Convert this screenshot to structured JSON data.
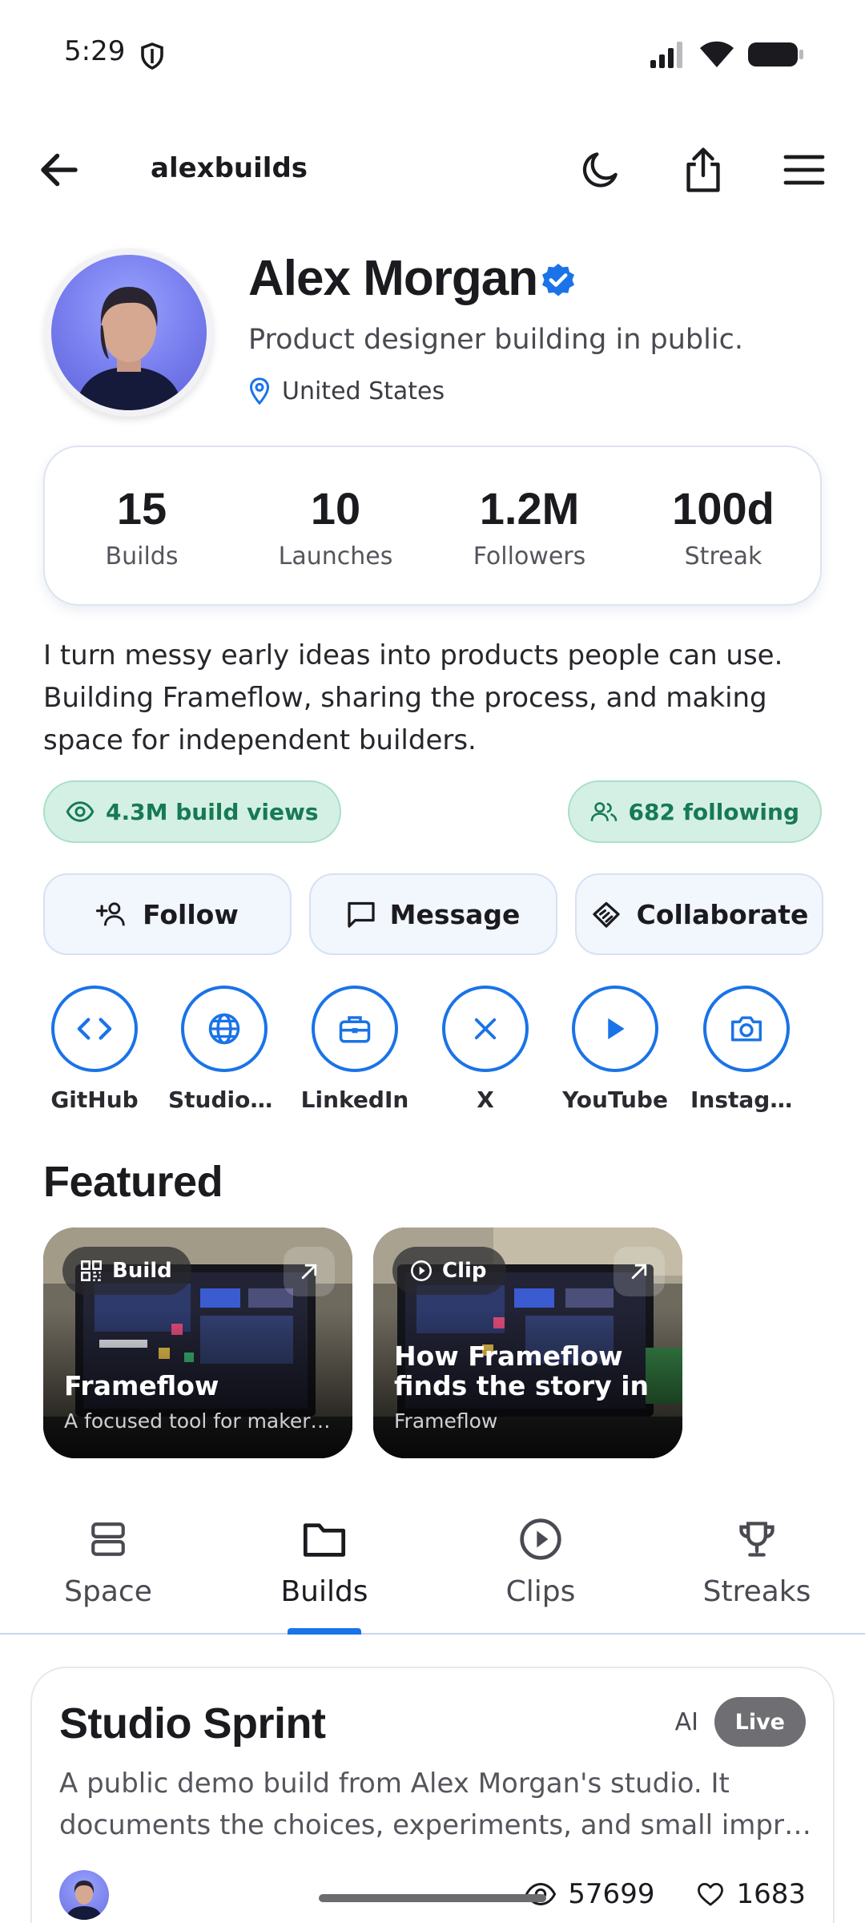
{
  "status_bar": {
    "time": "5:29"
  },
  "app_bar": {
    "handle": "alexbuilds"
  },
  "profile": {
    "name": "Alex Morgan",
    "tagline": "Product designer building in public.",
    "location": "United States"
  },
  "stats": [
    {
      "value": "15",
      "label": "Builds"
    },
    {
      "value": "10",
      "label": "Launches"
    },
    {
      "value": "1.2M",
      "label": "Followers"
    },
    {
      "value": "100d",
      "label": "Streak"
    }
  ],
  "bio": "I turn messy early ideas into products people can use. Building Frameflow, sharing the process, and making space for independent builders.",
  "chips": {
    "views": "4.3M build views",
    "following": "682 following"
  },
  "actions": {
    "follow": "Follow",
    "message": "Message",
    "collaborate": "Collaborate"
  },
  "socials": [
    {
      "label": "GitHub",
      "icon": "code-icon"
    },
    {
      "label": "Studio …",
      "icon": "globe-icon"
    },
    {
      "label": "LinkedIn",
      "icon": "briefcase-icon"
    },
    {
      "label": "X",
      "icon": "x-icon"
    },
    {
      "label": "YouTube",
      "icon": "play-icon"
    },
    {
      "label": "Instagr…",
      "icon": "camera-icon"
    }
  ],
  "featured": {
    "title": "Featured",
    "cards": [
      {
        "tag": "Build",
        "title": "Frameflow",
        "subtitle": "A focused tool for maker…"
      },
      {
        "tag": "Clip",
        "title": "How Frameflow finds the story in a…",
        "subtitle": "Frameflow"
      }
    ]
  },
  "tabs": [
    {
      "label": "Space",
      "icon": "layers-icon"
    },
    {
      "label": "Builds",
      "icon": "folder-icon"
    },
    {
      "label": "Clips",
      "icon": "play-circle-icon"
    },
    {
      "label": "Streaks",
      "icon": "trophy-icon"
    }
  ],
  "build_card": {
    "title": "Studio Sprint",
    "ai_label": "AI",
    "status": "Live",
    "description": "A public demo build from Alex Morgan's studio. It documents the choices, experiments, and small impr…",
    "views": "57699",
    "likes": "1683"
  },
  "colors": {
    "accent": "#1a73e8",
    "chip_green": "#177a55",
    "chip_bg": "#d4f0e4"
  }
}
